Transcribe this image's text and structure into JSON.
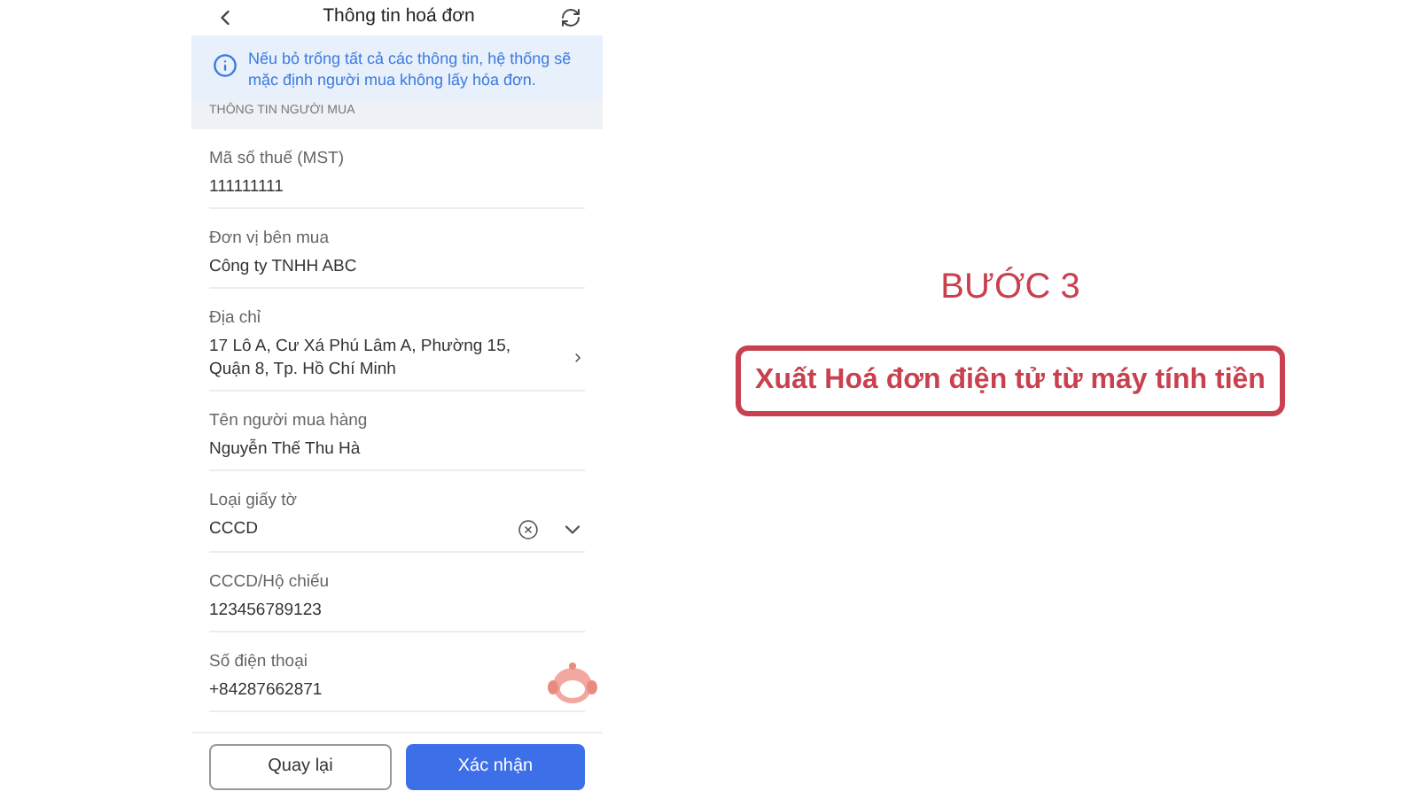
{
  "header": {
    "title": "Thông tin hoá đơn"
  },
  "notice": "Nếu bỏ trống tất cả các thông tin, hệ thống sẽ mặc định người mua không lấy hóa đơn.",
  "section_label": "THÔNG TIN NGƯỜI MUA",
  "fields": [
    {
      "kind": "text",
      "label": "Mã số thuế (MST)",
      "value": "111111111"
    },
    {
      "kind": "text",
      "label": "Đơn vị bên mua",
      "value": "Công ty TNHH ABC"
    },
    {
      "kind": "link",
      "label": "Địa chỉ",
      "value": "17 Lô A, Cư Xá Phú Lâm A, Phường 15, Quận 8, Tp. Hồ Chí Minh"
    },
    {
      "kind": "text",
      "label": "Tên người mua hàng",
      "value": "Nguyễn Thế Thu Hà"
    },
    {
      "kind": "select",
      "label": "Loại giấy tờ",
      "value": "CCCD"
    },
    {
      "kind": "text",
      "label": "CCCD/Hộ chiếu",
      "value": "123456789123"
    },
    {
      "kind": "text",
      "label": "Số điện thoại",
      "value": "+84287662871"
    }
  ],
  "buttons": [
    {
      "kind": "secondary",
      "label": "Quay lại"
    },
    {
      "kind": "primary",
      "label": "Xác nhận"
    }
  ],
  "step": {
    "title": "BƯỚC 3",
    "caption": "Xuất Hoá đơn điện tử từ máy tính tiền"
  }
}
